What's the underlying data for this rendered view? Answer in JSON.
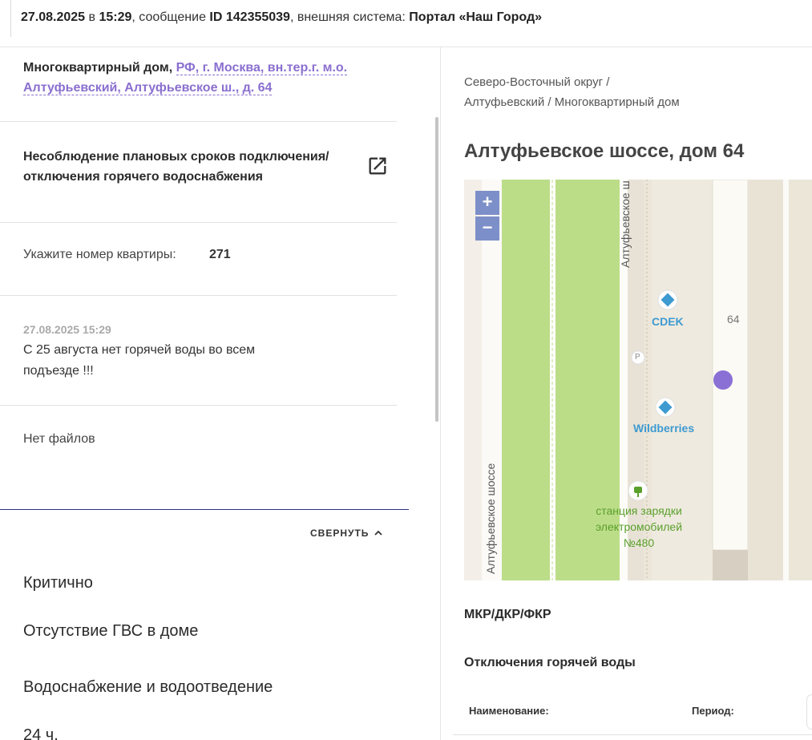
{
  "header": {
    "date": "27.08.2025",
    "in_word": " в ",
    "time": "15:29",
    "message_prefix": ", сообщение ",
    "message_id": "ID 142355039",
    "system_prefix": ", внешняя система: ",
    "system_name": "Портал «Наш Город»"
  },
  "address": {
    "type_label": "Многоквартирный дом, ",
    "link_text": "РФ, г. Москва, вн.тер.г. м.о. Алтуфьевский, Алтуфьевское ш., д. 64"
  },
  "problem": {
    "title": "Несоблюдение плановых сроков подключения/ отключения горячего водоснабжения",
    "open_icon": "open-in-new-icon"
  },
  "apartment": {
    "label": "Укажите номер квартиры:",
    "value": "271"
  },
  "message": {
    "date": "27.08.2025 15:29",
    "text": "С 25 августа нет горячей воды во всем подъезде !!!"
  },
  "files": {
    "empty_text": "Нет файлов"
  },
  "collapse": {
    "label": "СВЕРНУТЬ"
  },
  "details": {
    "priority": "Критично",
    "category": "Отсутствие ГВС в доме",
    "group": "Водоснабжение и водоотведение",
    "deadline": "24 ч."
  },
  "right": {
    "breadcrumb_line1": "Северо-Восточный округ /",
    "breadcrumb_line2": "Алтуфьевский / Многоквартирный дом",
    "title": "Алтуфьевское шоссе, дом 64",
    "map": {
      "zoom_in": "+",
      "zoom_out": "−",
      "road_label": "Алтуфьевское шоссе",
      "road_label_2": "Алтуфьевское ш",
      "house_number": "64",
      "cdek": "CDEK",
      "wildberries": "Wildberries",
      "parking": "P",
      "charging_line1": "станция зарядки",
      "charging_line2": "электромобилей",
      "charging_line3": "№480",
      "colors": {
        "green": "#bcdd88",
        "marker": "#8a6fd4",
        "poi": "#3d9ad1",
        "charge": "#5aa02c"
      }
    },
    "section_mkr": "МКР/ДКР/ФКР",
    "section_hot_water": "Отключения горячей воды",
    "table": {
      "col_name": "Наименование:",
      "col_period": "Период:"
    }
  }
}
